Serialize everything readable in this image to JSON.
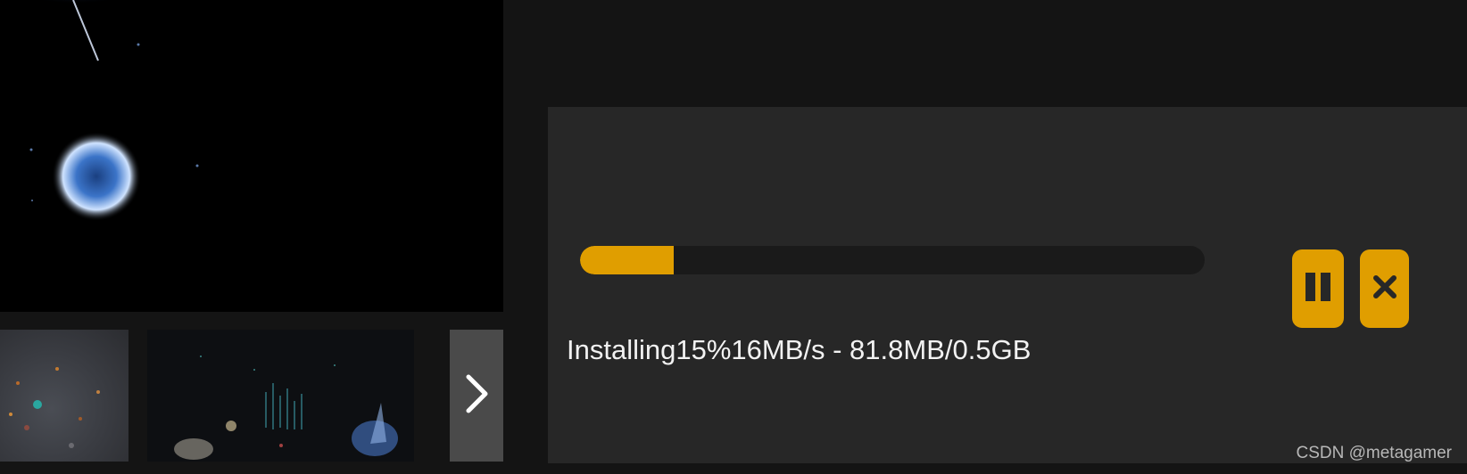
{
  "install": {
    "status_text": "Installing15%16MB/s - 81.8MB/0.5GB",
    "progress_fraction": 0.15,
    "pause_icon": "pause-icon",
    "cancel_icon": "close-icon"
  },
  "gallery": {
    "next_icon": "chevron-right-icon"
  },
  "watermark": "CSDN @metagamer",
  "colors": {
    "accent": "#e09e00",
    "panel": "#272727",
    "background": "#141414",
    "track": "#1a1a1a"
  }
}
